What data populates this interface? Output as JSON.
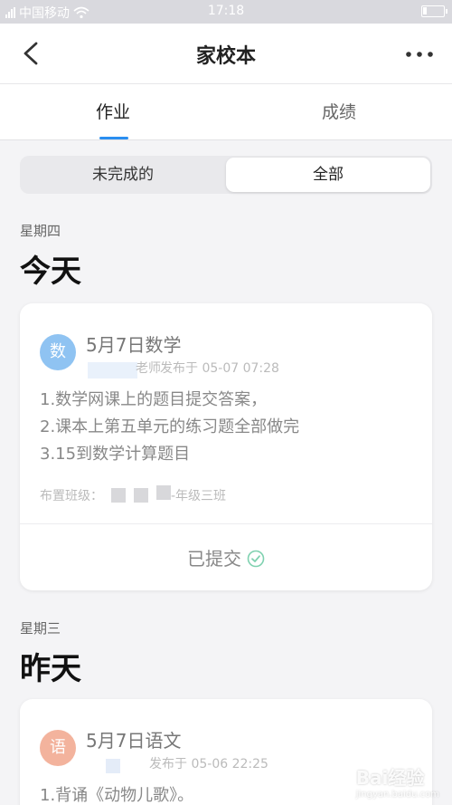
{
  "status_bar": {
    "carrier": "中国移动",
    "time": "17:18"
  },
  "header": {
    "title": "家校本"
  },
  "tabs": [
    {
      "label": "作业"
    },
    {
      "label": "成绩"
    }
  ],
  "segment": {
    "incomplete": "未完成的",
    "all": "全部"
  },
  "sections": [
    {
      "weekday": "星期四",
      "day": "今天",
      "card": {
        "avatar_text": "数",
        "avatar_color": "#8fc3f2",
        "title": "5月7日数学",
        "teacher": "老师",
        "published": "发布于 05-07 07:28",
        "lines": [
          "1.数学网课上的题目提交答案，",
          "2.课本上第五单元的练习题全部做完",
          "3.15到数学计算题目"
        ],
        "class_label": "布置班级：",
        "class_suffix": "-年级三班",
        "status": "已提交"
      }
    },
    {
      "weekday": "星期三",
      "day": "昨天",
      "card": {
        "avatar_text": "语",
        "avatar_color": "#f3b39d",
        "title": "5月7日语文",
        "published": "发布于 05-06 22:25",
        "lines": [
          "1.背诵《动物儿歌》。"
        ]
      }
    }
  ],
  "colors": {
    "accent": "#2a8ef0",
    "check": "#7fd1b0"
  },
  "watermark": {
    "brand": "Bai经验",
    "url": "jingyan.baidu.com"
  }
}
